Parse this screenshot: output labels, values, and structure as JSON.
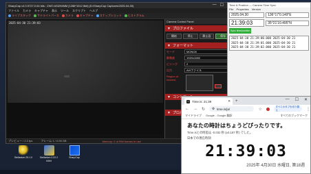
{
  "sharpcap": {
    "title": "SharpCap v4.0.9727.0 64 bits : ZWO ASI294MM [1286*1012 8bit] (D:\\SharpCap Captures\\2025-04-30)",
    "win_controls": [
      "—",
      "☐",
      "✕"
    ],
    "menu": [
      "ファイル",
      "カメラ",
      "キャプチャ",
      "表示",
      "ツール",
      "スクリプト",
      "ヘルプ"
    ],
    "toolbar": [
      "ライブスタック",
      "サテライトパース",
      "カメラ",
      "キャプチャ",
      "スナップショット",
      "ヒストグラム"
    ],
    "preview_timestamp": "2025-04-30 21:39:03 ",
    "status_left": "プレビュー / 2.3 fps",
    "status_mid": "フレーム 1 / 0.05 GB",
    "status_memory": "Memory: 0 of 996 frames in use"
  },
  "ccp": {
    "header": "Camera Control Panel",
    "section_capture": "プロファイル",
    "buttons": [
      "開始",
      "停止",
      "静止画",
      "保存"
    ],
    "section_format": "フォーマット",
    "fields": [
      {
        "label": "モード",
        "value": "MONO8"
      },
      {
        "label": "解像度",
        "value": "1920x1080"
      },
      {
        "label": "ビニング",
        "value": "2"
      },
      {
        "label": "出力",
        "value": "AVIファイル"
      }
    ],
    "roi_label": "Region of Interest",
    "section_control": "コントロール",
    "section_prop": "プロパティ"
  },
  "gps": {
    "title": "Time & Position — Camera Time Sync",
    "menu": [
      "File",
      "Properties",
      "Version"
    ],
    "date": "2025.04.30",
    "lon": "136°17'0.149\"E",
    "time": "21:39:03",
    "lat": "35°21'10.495\"N",
    "sync_label": "Sync time/position",
    "log": [
      "2025-04-30 21:39:00.000 2025-04-30 21",
      "2025-04-30 21:39:01.000 2025-04-30 21",
      "2025-04-30 21:39:02.000 2025-04-30 21",
      "2025-04-30 21:39:03.000 2025-04-30 21"
    ]
  },
  "chrome": {
    "tab_title": "Time.is: 21:39",
    "url": "time.is/ja/",
    "profile_label": "すべてのタブを切り替え",
    "bookmarks": [
      "マイドライブ",
      "Google - Google 翻訳"
    ],
    "bookmarks_right": "すべてのブックマーク",
    "headline": "あなたの時計はちょうどぴったりです。",
    "sub1": "Time.isとの時差は -0.032 秒 (±0.187 秒) でした。",
    "sub2": "日本での現在時刻:",
    "clock": "21:39:03",
    "date": "2025年 4月30日 水曜日, 第18週"
  },
  "desktop_icons": [
    {
      "label": "Stellarium 25.1.0"
    },
    {
      "label": "Stellarium 0.22.2 64bit"
    },
    {
      "label": "SharpCap"
    }
  ],
  "colors": {
    "accent_red": "#a32020",
    "toolbar_red": "#f07070",
    "green": "#2fae3a"
  }
}
